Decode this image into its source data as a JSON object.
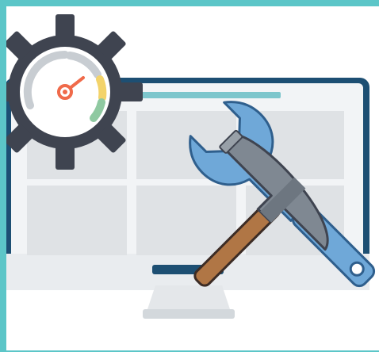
{
  "illustration": {
    "colors": {
      "frame_teal": "#5cc6c8",
      "monitor_navy": "#1d4f73",
      "monitor_screen": "#f2f4f6",
      "monitor_stand": "#e4e7ea",
      "screen_block": "#dfe2e5",
      "title_bar": "#7dc6cc",
      "gear": "#3f4450",
      "gauge_face": "#ffffff",
      "gauge_grey": "#c8cdd2",
      "gauge_yellow": "#f3d36a",
      "gauge_green": "#8fc9a1",
      "needle": "#f06a4a",
      "hammer_head": "#7f8892",
      "hammer_handle": "#b07645",
      "wrench": "#6fa8d8",
      "wrench_outline": "#2f5f8d"
    },
    "icons": [
      "gear-icon",
      "speedometer-icon",
      "monitor-icon",
      "hammer-icon",
      "wrench-icon"
    ]
  }
}
